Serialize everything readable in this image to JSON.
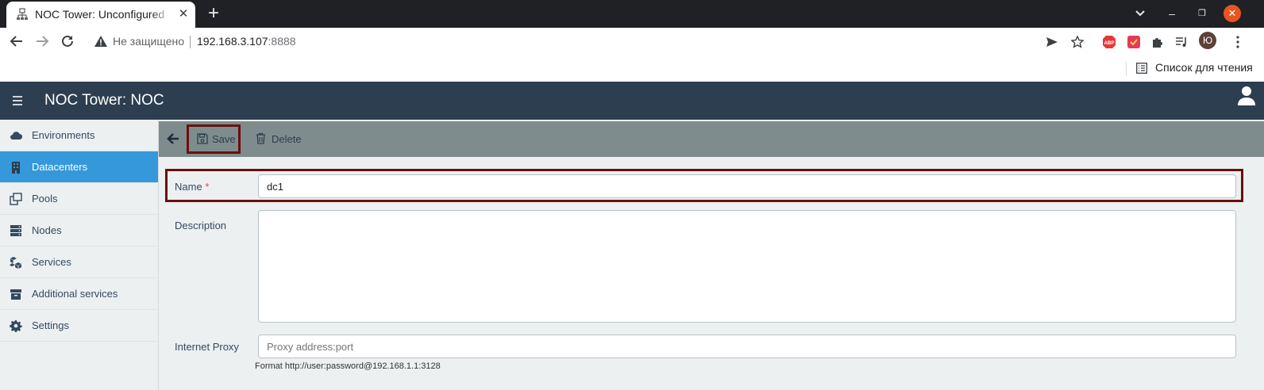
{
  "browser": {
    "tab_title": "NOC Tower: Unconfigured",
    "tab_close": "✕",
    "new_tab": "+",
    "window_controls": {
      "minimize": "–",
      "maximize": "❐",
      "close": "✕"
    },
    "not_secure_label": "Не защищено",
    "url_host": "192.168.3.107",
    "url_port": ":8888",
    "extensions": [
      "send-icon",
      "star-icon",
      "adblock-icon",
      "extension-colorful-icon",
      "puzzle-icon",
      "media-queue-icon",
      "profile-avatar"
    ],
    "extension_badge_text": "ABP",
    "profile_initial": "Ю",
    "reading_list_label": "Список для чтения",
    "colors": {
      "tabstrip": "#202124",
      "close_button": "#e95420"
    }
  },
  "app": {
    "title": "NOC Tower: NOC",
    "colors": {
      "header": "#2d3e50",
      "sidebar": "#ecf0f1",
      "active": "#3498db",
      "toolbar": "#7f8c8d",
      "highlight_frame": "#6b0f0f"
    }
  },
  "sidebar": {
    "items": [
      {
        "label": "Environments",
        "icon": "cloud-icon"
      },
      {
        "label": "Datacenters",
        "icon": "building-icon",
        "active": true
      },
      {
        "label": "Pools",
        "icon": "pools-icon"
      },
      {
        "label": "Nodes",
        "icon": "server-icon"
      },
      {
        "label": "Services",
        "icon": "cubes-icon"
      },
      {
        "label": "Additional services",
        "icon": "archive-icon"
      },
      {
        "label": "Settings",
        "icon": "gear-icon"
      }
    ]
  },
  "form": {
    "toolbar": {
      "save_label": "Save",
      "delete_label": "Delete"
    },
    "name": {
      "label": "Name",
      "required_mark": "*",
      "value": "dc1"
    },
    "description": {
      "label": "Description",
      "value": ""
    },
    "proxy": {
      "label": "Internet Proxy",
      "placeholder": "Proxy address:port",
      "hint": "Format http://user:password@192.168.1.1:3128"
    }
  }
}
